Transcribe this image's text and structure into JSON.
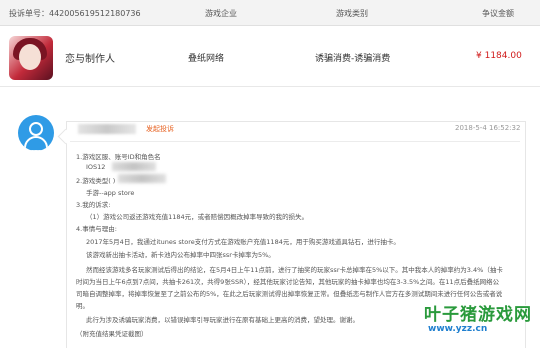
{
  "header": {
    "complaint_no": "投诉单号：442005619512180736",
    "col_company": "游戏企业",
    "col_category": "游戏类别",
    "col_amount": "争议金额"
  },
  "complaint": {
    "game_name": "恋与制作人",
    "company": "叠纸网络",
    "category": "诱骗消费-诱骗消费",
    "amount": "¥ 1184.00"
  },
  "post": {
    "status": "发起投诉",
    "time": "2018-5-4 16:52:32",
    "lines": [
      "1.游戏区服、账号ID和角色名",
      "IOS12",
      "2.游戏类型(                    )",
      "手游--app store",
      "3.我的诉求:",
      "（1）游戏公司返还游戏充值1184元，或者赔偿因概改掉率导致的我的损失。",
      "4.事情与理由:",
      "2017年5月4日，我通过itunes store支付方式在游戏账户充值1184元，用于购买游戏道具钻石，进行抽卡。",
      "该游戏新出抽卡活动，新卡池内公布掉率中四张ssr卡掉率为5%。",
      "然而经该游戏多名玩家测试后得出的结论，在5月4日上午11点前，进行了抽奖的玩家ssr卡总掉率在5%以下。其中我本人的掉率约为3.4%（抽卡",
      "时间为当日上午6点到7点间，共抽卡261次，共得9张SSR），经其他玩家讨论告知，其他玩家的抽卡掉率也均在3-3.5%之间。在11点后叠纸网络公",
      "司暗自调整掉率，将掉率恢复至了之前公布的5%，在此之后玩家测试得出掉率恢复正常。但叠纸恋与制作人官方在多测试期间未进行任何公告或者说",
      "明。",
      "此行为涉及诱骗玩家消费，以错误掉率引导玩家进行在原有基础上更高的消费，望处理。谢谢。",
      "（附充值结果凭证截图）"
    ]
  },
  "watermark": {
    "brand": "叶子猪游戏网",
    "url": "www.yzz.cn"
  },
  "colors": {
    "accent_red": "#d01a1a",
    "status_orange": "#e65c1a",
    "avatar_blue": "#2f9be6",
    "watermark_green": "#2a9a3c"
  }
}
